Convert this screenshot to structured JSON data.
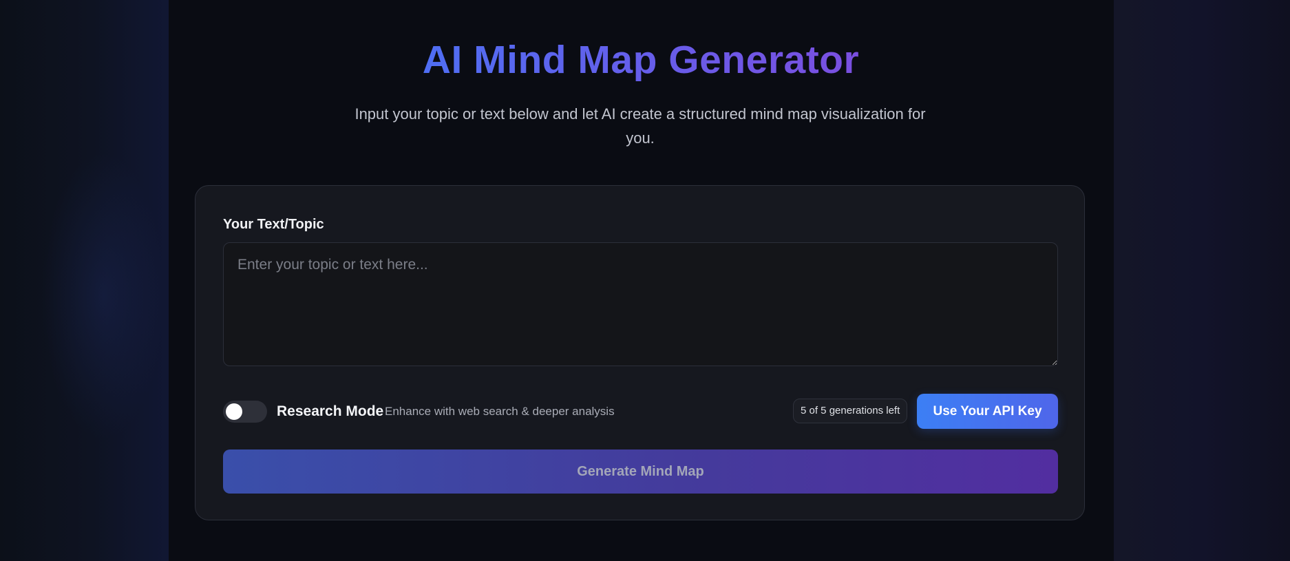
{
  "header": {
    "title": "AI Mind Map Generator",
    "subtitle": "Input your topic or text below and let AI create a structured mind map visualization for you."
  },
  "form": {
    "field_label": "Your Text/Topic",
    "textarea_value": "",
    "textarea_placeholder": "Enter your topic or text here...",
    "research_mode": {
      "label": "Research Mode",
      "description": "Enhance with web search & deeper analysis",
      "enabled": false
    },
    "generations_badge": "5 of 5 generations left",
    "api_key_button": "Use Your API Key",
    "generate_button": "Generate Mind Map"
  },
  "colors": {
    "title_gradient_start": "#4f6ef3",
    "title_gradient_end": "#7a4fe0",
    "api_button": "#3c7ff5",
    "generate_button_start": "#3a4faa",
    "generate_button_end": "#522ea0",
    "background": "#0b0d14",
    "card": "#16181f"
  }
}
